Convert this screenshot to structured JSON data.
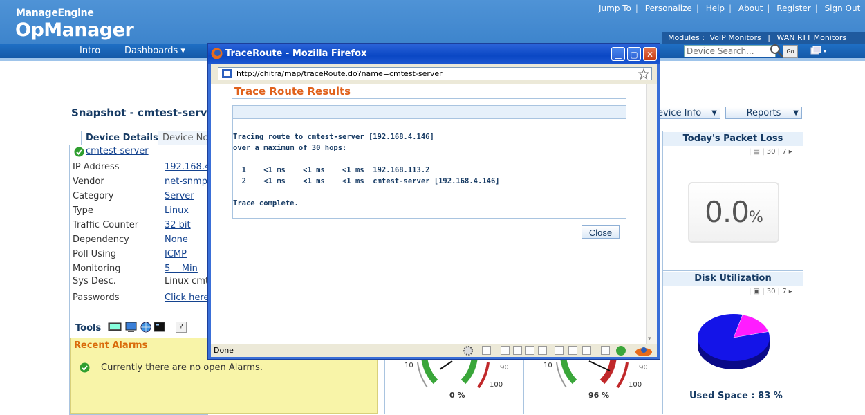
{
  "header": {
    "brand": "ManageEngine",
    "product": "OpManager",
    "top_links": [
      "Jump To",
      "Personalize",
      "Help",
      "About",
      "Register",
      "Sign Out"
    ],
    "modules_label": "Modules :",
    "modules": [
      "VoIP Monitors",
      "WAN RTT Monitors"
    ]
  },
  "nav": {
    "items": [
      "Intro",
      "Dashboards ▾"
    ],
    "search_placeholder": "Device Search...",
    "go_label": "Go"
  },
  "snapshot": {
    "title": "Snapshot - cmtest-server",
    "tabs": [
      "Device Details",
      "Device No"
    ],
    "device_name": "cmtest-server",
    "fields": [
      {
        "label": "IP Address",
        "value": "192.168.4"
      },
      {
        "label": "Vendor",
        "value": "net-snmp"
      },
      {
        "label": "Category",
        "value": "Server"
      },
      {
        "label": "Type",
        "value": "Linux"
      },
      {
        "label": "Traffic Counter",
        "value": "32 bit"
      },
      {
        "label": "Dependency",
        "value": "None"
      },
      {
        "label": "Poll Using",
        "value": "ICMP"
      },
      {
        "label": "Monitoring",
        "value": "5    Min"
      },
      {
        "label": "Sys Desc.",
        "value": "Linux cmte"
      },
      {
        "label": "Passwords",
        "value": "Click here"
      }
    ],
    "tools_label": "Tools",
    "tools_help": "?",
    "recent_alarms_title": "Recent Alarms",
    "alarms_message": "Currently there are no open Alarms."
  },
  "right": {
    "device_info_btn": "evice Info",
    "reports_btn": "Reports",
    "packet_loss_title": "Today's Packet Loss",
    "packet_loss_value": "0.0",
    "packet_loss_unit": "%",
    "panel_controls": "30",
    "panel_controls_2": "7",
    "disk_title": "Disk Utilization",
    "used_space": "Used Space : 83 %",
    "used_space_pct": 83,
    "gauges": [
      {
        "value_label": "0 %",
        "ticks": [
          "10",
          "90",
          "100"
        ]
      },
      {
        "value_label": "96 %",
        "ticks": [
          "10",
          "90",
          "100"
        ]
      }
    ]
  },
  "popup": {
    "window_title": "TraceRoute - Mozilla Firefox",
    "url": "http://chitra/map/traceRoute.do?name=cmtest-server",
    "heading": "Trace Route Results",
    "lines": [
      "Tracing route to cmtest-server [192.168.4.146]",
      "over a maximum of 30 hops:",
      "",
      "  1    <1 ms    <1 ms    <1 ms  192.168.113.2",
      "  2    <1 ms    <1 ms    <1 ms  cmtest-server [192.168.4.146]",
      "",
      "Trace complete."
    ],
    "close_label": "Close",
    "status": "Done"
  },
  "colors": {
    "header_blue": "#3d84cc",
    "accent_orange": "#e0621c",
    "pie_blue": "#1414e8",
    "pie_magenta": "#ff1cff"
  }
}
